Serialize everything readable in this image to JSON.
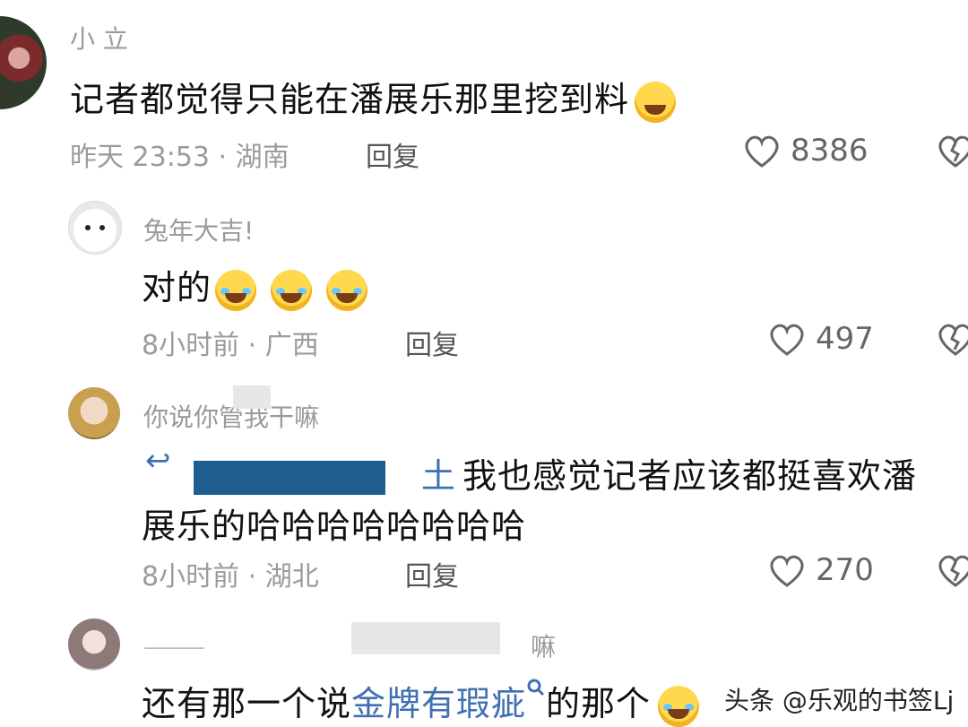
{
  "comments": [
    {
      "username": "小 立",
      "text": "记者都觉得只能在潘展乐那里挖到料",
      "time_location": "昨天 23:53 · 湖南",
      "reply_label": "回复",
      "likes": "8386"
    },
    {
      "username": "兔年大吉!",
      "text": "对的",
      "time_location": "8小时前 · 广西",
      "reply_label": "回复",
      "likes": "497"
    },
    {
      "username": "你说你管我干嘛",
      "mention_prefix": "土",
      "text_line1": "我也感觉记者应该都挺喜欢潘",
      "text_line2": "展乐的哈哈哈哈哈哈哈哈",
      "time_location": "8小时前 · 湖北",
      "reply_label": "回复",
      "likes": "270"
    },
    {
      "username_suffix": "嘛",
      "text_prefix": "还有那一个说",
      "link_text": "金牌有瑕疵",
      "text_suffix": "的那个"
    }
  ],
  "watermark": "头条 @乐观的书签Lj",
  "icons": [
    "heart-icon",
    "dislike-icon",
    "search-icon"
  ]
}
